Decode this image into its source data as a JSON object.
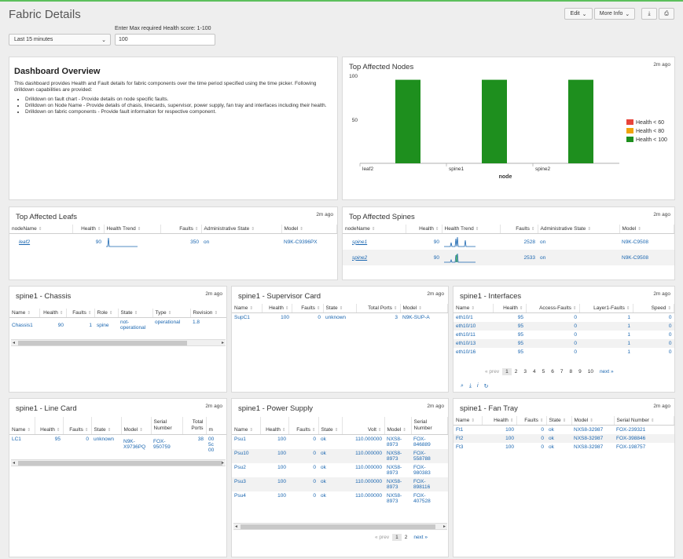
{
  "header": {
    "title": "Fabric Details",
    "edit": "Edit",
    "more_info": "More Info"
  },
  "inputs": {
    "time_value": "Last 15 minutes",
    "health_label": "Enter Max required Health score: 1-100",
    "health_value": "100"
  },
  "overview": {
    "title": "Dashboard Overview",
    "intro": "This dashboard provides Health and Fault details for fabric components over the time period specified using the time picker. Following drilldown capabilities are provided:",
    "bullets": [
      "Drilldown on fault chart - Provide details on node specific faults.",
      "Drilldown on Node Name - Provide details of chasis, linecards, supervisor, power supply, fan tray and interfaces including their health.",
      "Drilldown on fabric components - Provide fault informaiton for respective component."
    ]
  },
  "top_nodes": {
    "title": "Top Affected Nodes",
    "ago": "2m ago"
  },
  "chart_data": {
    "type": "bar",
    "categories": [
      "leaf2",
      "spine1",
      "spine2"
    ],
    "series": [
      {
        "name": "Health < 100",
        "values": [
          95,
          95,
          95
        ]
      }
    ],
    "xlabel": "node",
    "ylabel": "",
    "ylim": [
      0,
      100
    ],
    "yticks": [
      "100",
      "50"
    ],
    "legend": [
      {
        "label": "Health < 60",
        "color": "#e8443a"
      },
      {
        "label": "Health < 80",
        "color": "#f0a30a"
      },
      {
        "label": "Health < 100",
        "color": "#1e8f1e"
      }
    ],
    "legend_position": "right"
  },
  "leafs": {
    "title": "Top Affected Leafs",
    "ago": "2m ago",
    "cols": [
      "nodeName",
      "Health",
      "Health Trend",
      "Faults",
      "Administrative State",
      "Model"
    ],
    "rows": [
      [
        "leaf2",
        "90",
        "",
        "350",
        "on",
        "N9K-C9396PX"
      ]
    ]
  },
  "spines": {
    "title": "Top Affected Spines",
    "ago": "2m ago",
    "cols": [
      "nodeName",
      "Health",
      "Health Trend",
      "Faults",
      "Administrative State",
      "Model"
    ],
    "rows": [
      [
        "spine1",
        "90",
        "",
        "2528",
        "on",
        "N9K-C9508"
      ],
      [
        "spine2",
        "90",
        "",
        "2533",
        "on",
        "N9K-C9508"
      ]
    ]
  },
  "chassis": {
    "title": "spine1 - Chassis",
    "ago": "2m ago",
    "cols": [
      "Name",
      "Health",
      "Faults",
      "Role",
      "State",
      "Type",
      "Revision"
    ],
    "row": {
      "name": "Chassis1",
      "health": "90",
      "faults": "1",
      "role": "spine",
      "state1": "not-",
      "state2": "operational",
      "type": "operational",
      "revision": "1.8"
    }
  },
  "supervisor": {
    "title": "spine1 - Supervisor Card",
    "ago": "2m ago",
    "cols": [
      "Name",
      "Health",
      "Faults",
      "State",
      "Total Ports",
      "Model"
    ],
    "rows": [
      [
        "SupC1",
        "100",
        "0",
        "unknown",
        "3",
        "N9K-SUP-A"
      ]
    ]
  },
  "interfaces": {
    "title": "spine1 - Interfaces",
    "ago": "2m ago",
    "cols": [
      "Name",
      "Health",
      "Access-Faults",
      "Layer1-Faults",
      "Speed"
    ],
    "rows": [
      [
        "eth10/1",
        "95",
        "0",
        "1",
        "0"
      ],
      [
        "eth10/10",
        "95",
        "0",
        "1",
        "0"
      ],
      [
        "eth10/11",
        "95",
        "0",
        "1",
        "0"
      ],
      [
        "eth10/13",
        "95",
        "0",
        "1",
        "0"
      ],
      [
        "eth10/16",
        "95",
        "0",
        "1",
        "0"
      ]
    ],
    "pager": {
      "prev": "« prev",
      "pages": [
        "1",
        "2",
        "3",
        "4",
        "5",
        "6",
        "7",
        "8",
        "9",
        "10"
      ],
      "next": "next »"
    }
  },
  "linecard": {
    "title": "spine1 - Line Card",
    "ago": "2m ago",
    "cols": [
      "Name",
      "Health",
      "Faults",
      "State",
      "Model",
      "Serial Number",
      "Total Ports",
      "m"
    ],
    "row": {
      "name": "LC1",
      "health": "95",
      "faults": "0",
      "state": "unknown",
      "model1": "N9K-",
      "model2": "X9736PQ",
      "sn1": "FOX-",
      "sn2": "950759",
      "ports": "38",
      "m1": "00",
      "m2": "5c",
      "m3": "00"
    }
  },
  "psu": {
    "title": "spine1 - Power Supply",
    "ago": "2m ago",
    "cols": [
      "Name",
      "Health",
      "Faults",
      "State",
      "Volt",
      "Model",
      "Serial Number"
    ],
    "rows": [
      [
        "Psu1",
        "100",
        "0",
        "ok",
        "110.000000",
        "NXS8-",
        "8973",
        "FOX-",
        "846889"
      ],
      [
        "Psu10",
        "100",
        "0",
        "ok",
        "110.000000",
        "NXS8-",
        "8973",
        "FOX-",
        "558788"
      ],
      [
        "Psu2",
        "100",
        "0",
        "ok",
        "110.000000",
        "NXS8-",
        "8973",
        "FOX-",
        "980383"
      ],
      [
        "Psu3",
        "100",
        "0",
        "ok",
        "110.000000",
        "NXS8-",
        "8973",
        "FOX-",
        "898116"
      ],
      [
        "Psu4",
        "100",
        "0",
        "ok",
        "110.000000",
        "NXS8-",
        "8973",
        "FOX-",
        "407528"
      ]
    ],
    "pager": {
      "prev": "« prev",
      "pages": [
        "1",
        "2"
      ],
      "next": "next »"
    }
  },
  "fantray": {
    "title": "spine1 - Fan Tray",
    "ago": "2m ago",
    "cols": [
      "Name",
      "Health",
      "Faults",
      "State",
      "Model",
      "Serial Number"
    ],
    "rows": [
      [
        "Ft1",
        "100",
        "0",
        "ok",
        "NXS8-32987",
        "FOX-239321"
      ],
      [
        "Ft2",
        "100",
        "0",
        "ok",
        "NXS8-32987",
        "FOX-398846"
      ],
      [
        "Ft3",
        "100",
        "0",
        "ok",
        "NXS8-32987",
        "FOX-198757"
      ]
    ]
  }
}
